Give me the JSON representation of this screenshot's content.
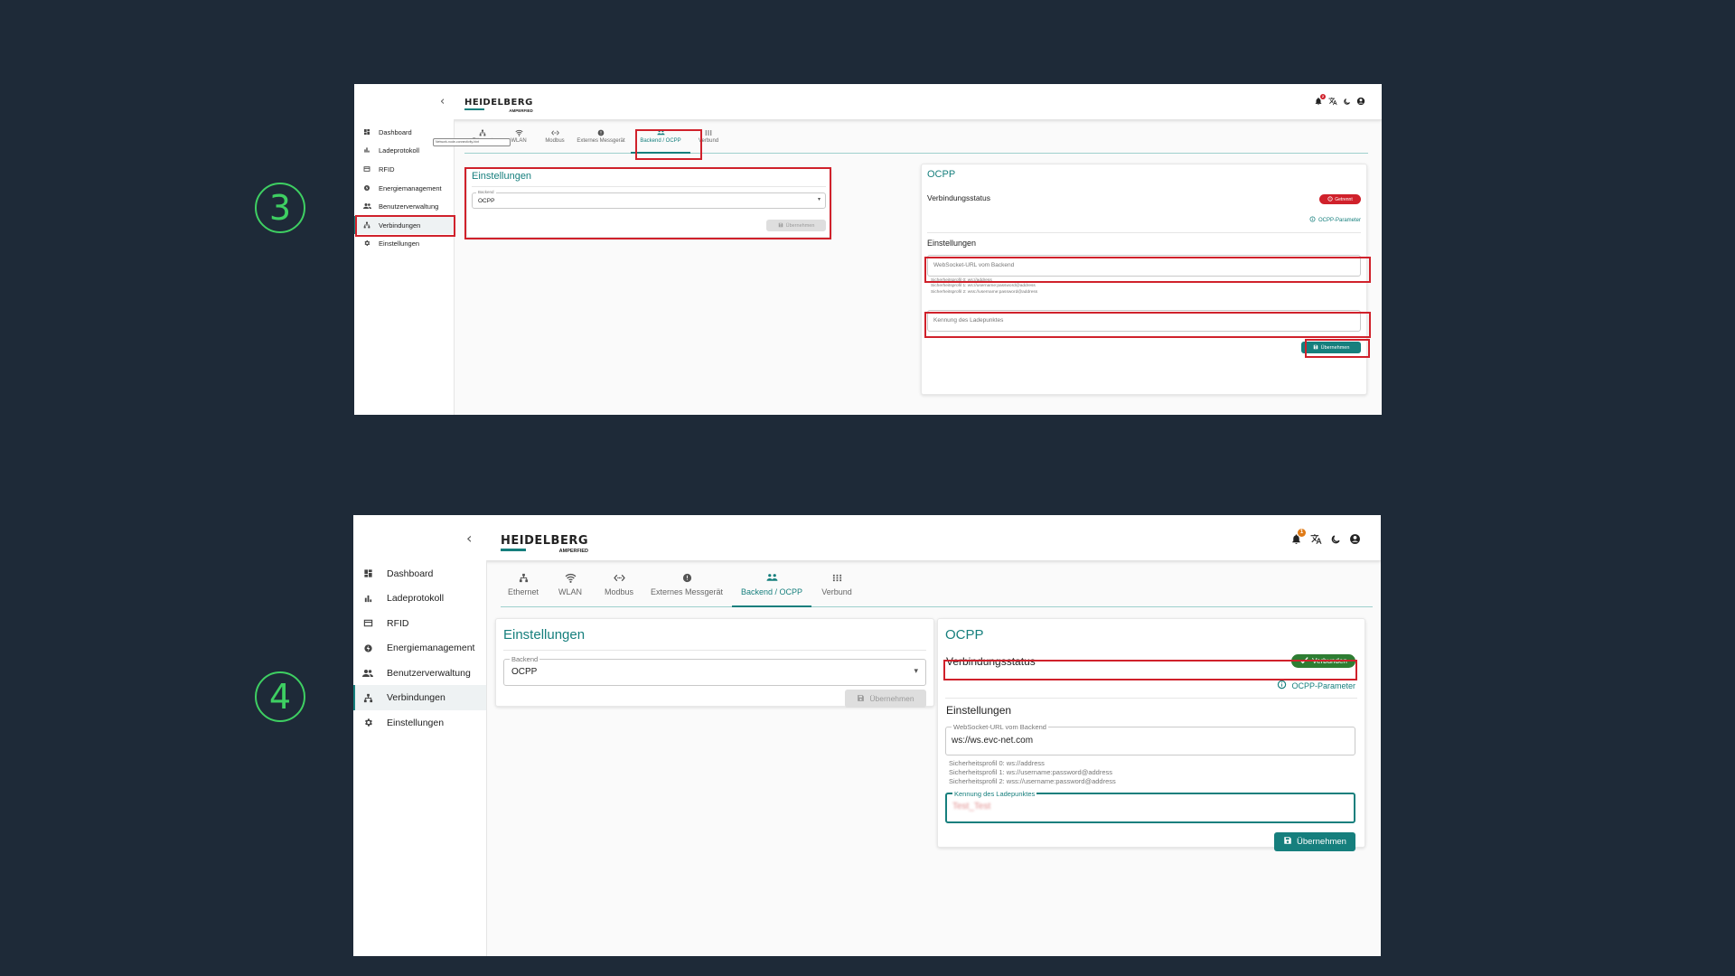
{
  "steps": [
    "3",
    "4"
  ],
  "header": {
    "brand": "HEIDELBERG",
    "sub_brand": "AMPERFIED",
    "collapse_glyph": "‹",
    "icons": [
      "bell-icon",
      "translate-icon",
      "moon-icon",
      "account-icon"
    ],
    "top_badge": "2",
    "bottom_badge": "1"
  },
  "sidebar": {
    "items": [
      {
        "label": "Dashboard",
        "icon": "dashboard-icon"
      },
      {
        "label": "Ladeprotokoll",
        "icon": "bar-chart-icon"
      },
      {
        "label": "RFID",
        "icon": "card-icon"
      },
      {
        "label": "Energiemanagement",
        "icon": "energy-icon"
      },
      {
        "label": "Benutzerverwaltung",
        "icon": "users-icon"
      },
      {
        "label": "Verbindungen",
        "icon": "network-icon"
      },
      {
        "label": "Einstellungen",
        "icon": "gear-icon"
      }
    ],
    "active_index": 5
  },
  "tabs": [
    {
      "label": "Ethernet",
      "icon": "ethernet-icon"
    },
    {
      "label": "WLAN",
      "icon": "wifi-icon"
    },
    {
      "label": "Modbus",
      "icon": "code-arrows-icon"
    },
    {
      "label": "Externes Messgerät",
      "icon": "meter-icon"
    },
    {
      "label": "Backend / OCPP",
      "icon": "backend-icon"
    },
    {
      "label": "Verbund",
      "icon": "grid-icon"
    }
  ],
  "active_tab_index": 4,
  "top_tooltip": "Network-node-connectivity-hint",
  "left_card": {
    "title": "Einstellungen",
    "backend_legend": "Backend",
    "backend_value": "OCPP",
    "apply_label": "Übernehmen"
  },
  "right_card": {
    "title": "OCPP",
    "status_label": "Verbindungsstatus",
    "status_top": "Getrennt",
    "status_bottom": "Verbunden",
    "ocpp_params_link": "OCPP-Parameter",
    "settings_title": "Einstellungen",
    "websocket_label": "WebSocket-URL vom Backend",
    "websocket_value": "ws://ws.evc-net.com",
    "security_hints": [
      "Sicherheitsprofil 0: ws://address",
      "Sicherheitsprofil 1: ws://username:password@address",
      "Sicherheitsprofil 2: wss://username:password@address"
    ],
    "charge_point_label": "Kennung des Ladepunktes",
    "charge_point_value": "Test_Test",
    "apply_label": "Übernehmen"
  },
  "colors": {
    "background": "#1e2a38",
    "accent": "#167f7d",
    "highlight": "#d0212b",
    "step": "#3ecf62",
    "connected": "#2e7d32",
    "disconnected": "#d0212b"
  }
}
